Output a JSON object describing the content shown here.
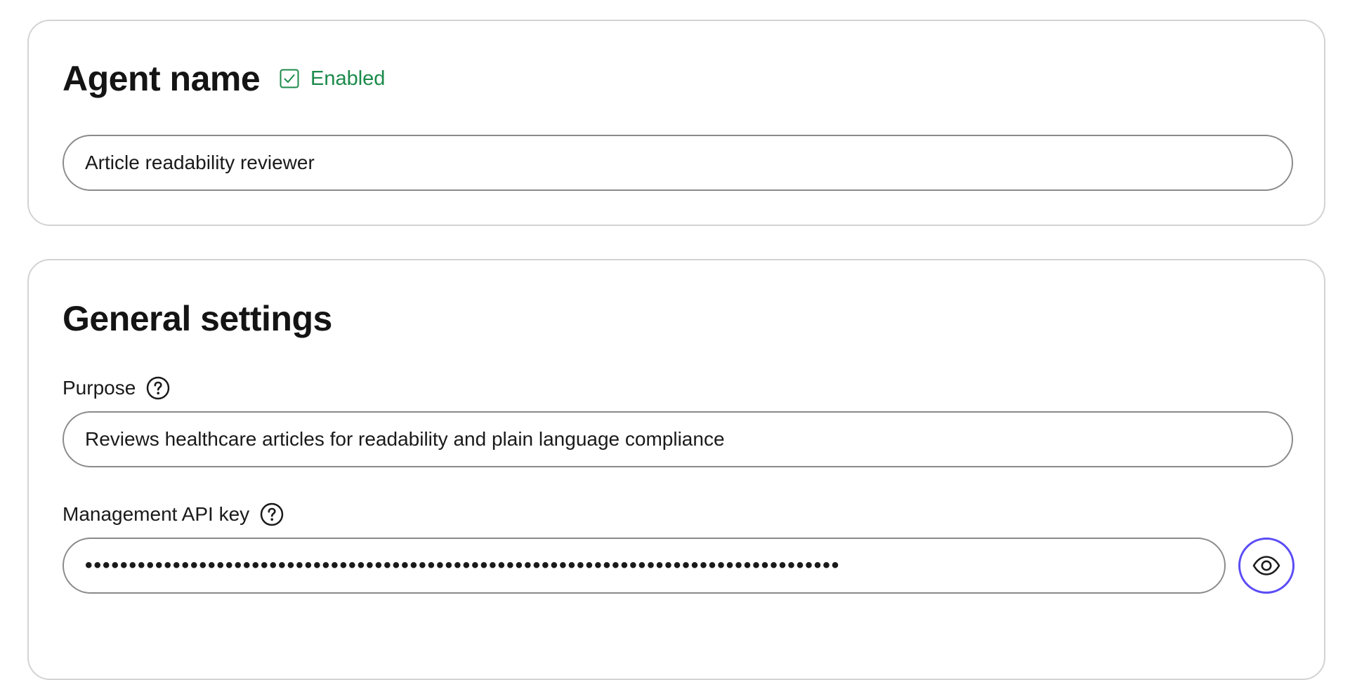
{
  "agent_card": {
    "title": "Agent name",
    "status_label": "Enabled",
    "name_value": "Article readability reviewer"
  },
  "general_card": {
    "title": "General settings",
    "purpose": {
      "label": "Purpose",
      "value": "Reviews healthcare articles for readability and plain language compliance"
    },
    "api_key": {
      "label": "Management API key",
      "masked_value": "••••••••••••••••••••••••••••••••••••••••••••••••••••••••••••••••••••••••••••••••••••••"
    }
  },
  "icons": {
    "status": "checkbox-checked-icon",
    "help": "help-circle-icon",
    "reveal": "eye-icon"
  },
  "colors": {
    "status_green": "#1b8a4a",
    "reveal_accent": "#5b4cf5",
    "card_border": "#d3d3d3",
    "input_border": "#8a8a8a"
  }
}
